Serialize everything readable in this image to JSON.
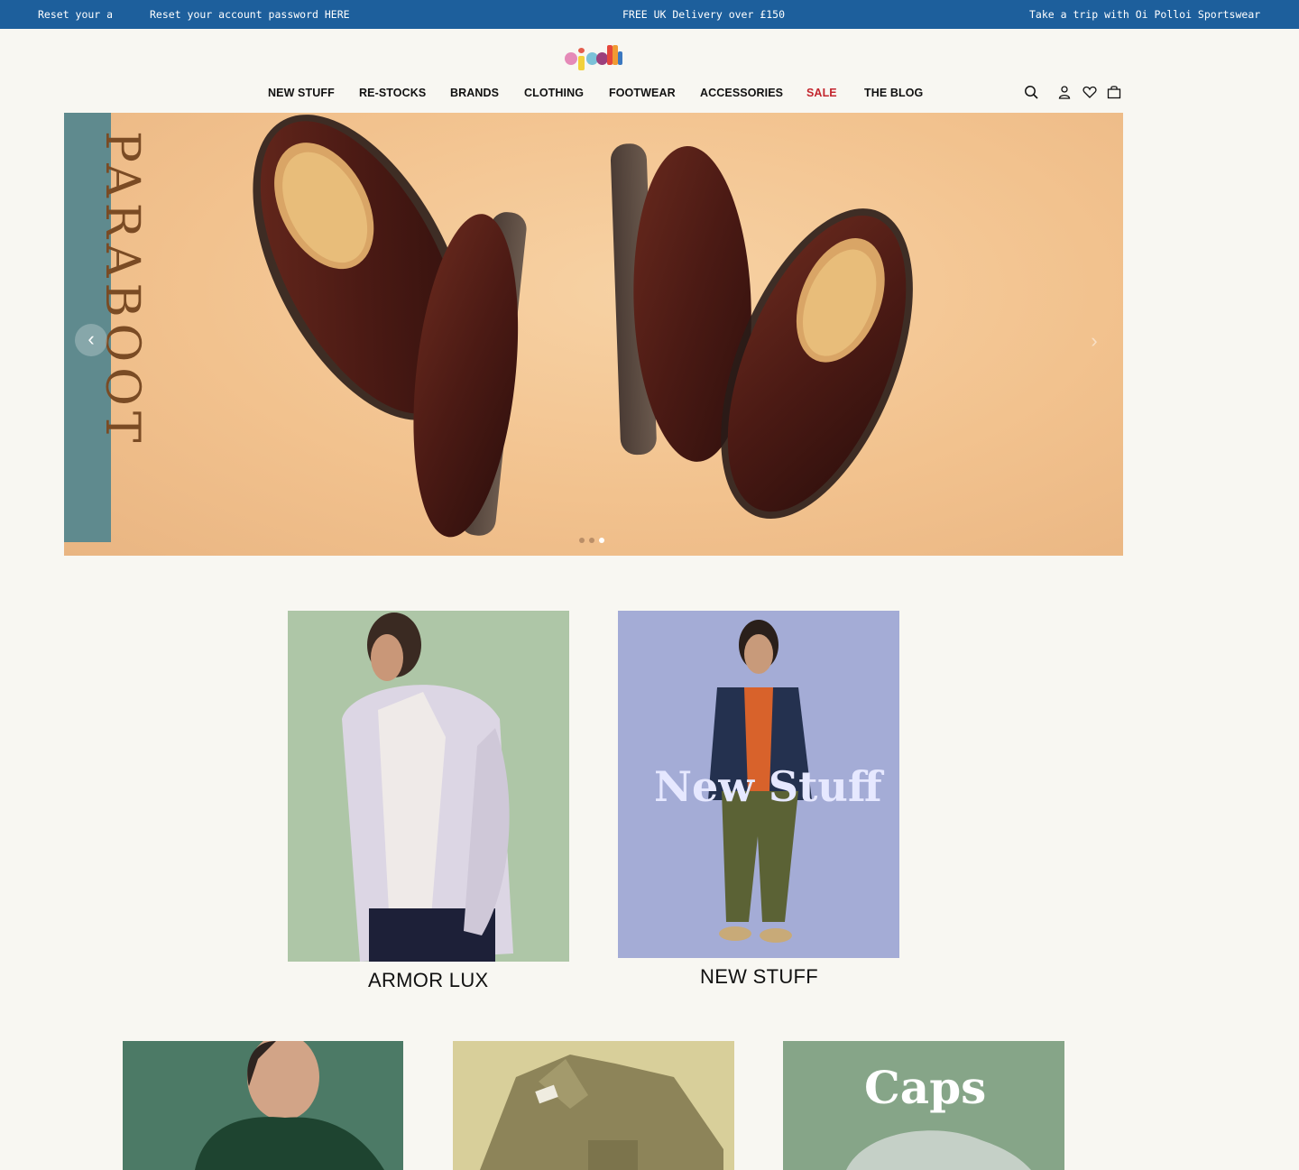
{
  "announcement": {
    "item1": "Reset your account password HERE",
    "item2": "Reset your account password HERE",
    "item3": "FREE UK Delivery over £150",
    "item4": "Take a trip with Oi Polloi Sportswear"
  },
  "header": {
    "nav": [
      {
        "label": "NEW STUFF"
      },
      {
        "label": "RE-STOCKS"
      },
      {
        "label": "BRANDS"
      },
      {
        "label": "CLOTHING"
      },
      {
        "label": "FOOTWEAR"
      },
      {
        "label": "ACCESSORIES"
      },
      {
        "label": "SALE",
        "color": "#c3262e"
      },
      {
        "label": "THE BLOG"
      }
    ],
    "icons": [
      "search-icon",
      "account-icon",
      "wishlist-icon",
      "bag-icon"
    ]
  },
  "hero": {
    "vertical_text": "PARABOOT",
    "prev_arrow": "‹",
    "next_arrow": "›",
    "slide_count": 3,
    "active_slide": 3
  },
  "tiles": [
    {
      "title": "ARMOR LUX",
      "overlay": ""
    },
    {
      "title": "NEW STUFF",
      "overlay": "New Stuff"
    },
    {
      "title": "",
      "overlay": ""
    },
    {
      "title": "",
      "overlay": ""
    },
    {
      "title": "",
      "overlay": "Caps"
    }
  ],
  "colors": {
    "announcement_bg": "#1d5f9c",
    "page_bg": "#f8f7f2",
    "sale": "#c3262e",
    "hero_bg": "#f2c28e",
    "hero_teal": "#5f8a8e"
  }
}
